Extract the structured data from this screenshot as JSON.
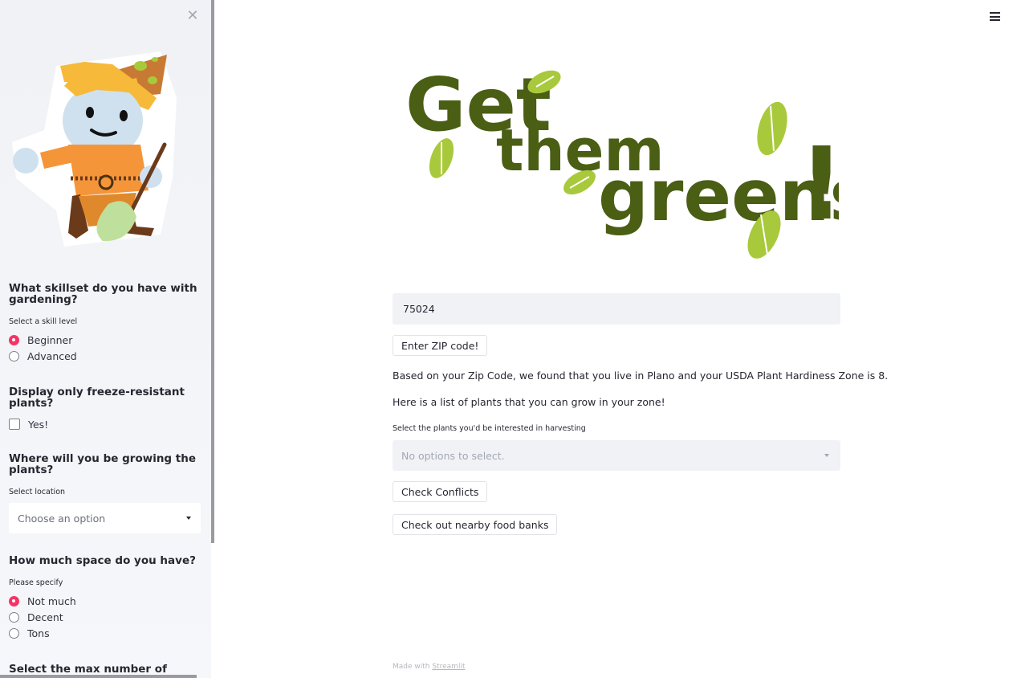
{
  "sidebar": {
    "close_icon": "close-icon",
    "skill": {
      "heading": "What skillset do you have with gardening?",
      "caption": "Select a skill level",
      "options": [
        {
          "label": "Beginner",
          "selected": true
        },
        {
          "label": "Advanced",
          "selected": false
        }
      ]
    },
    "freeze": {
      "heading": "Display only freeze-resistant plants?",
      "checkbox_label": "Yes!",
      "checked": false
    },
    "location": {
      "heading": "Where will you be growing the plants?",
      "caption": "Select location",
      "placeholder": "Choose an option"
    },
    "space": {
      "heading": "How much space do you have?",
      "caption": "Please specify",
      "options": [
        {
          "label": "Not much",
          "selected": true
        },
        {
          "label": "Decent",
          "selected": false
        },
        {
          "label": "Tons",
          "selected": false
        }
      ]
    },
    "months": {
      "heading": "Select the max number of months"
    }
  },
  "main": {
    "menu_icon": "hamburger-menu-icon",
    "logo_text": [
      "Get",
      "them",
      "greens",
      "!"
    ],
    "zip_value": "75024",
    "enter_zip_button": "Enter ZIP code!",
    "result_text": "Based on your Zip Code, we found that you live in Plano and your USDA Plant Hardiness Zone is 8.",
    "list_intro": "Here is a list of plants that you can grow in your zone!",
    "harvest_caption": "Select the plants you'd be interested in harvesting",
    "harvest_placeholder": "No options to select.",
    "check_conflicts_button": "Check Conflicts",
    "food_banks_button": "Check out nearby food banks",
    "footer_prefix": "Made with",
    "footer_link": "Streamlit"
  },
  "colors": {
    "accent": "#f63366",
    "sidebar_bg": "#f0f2f6",
    "logo_green": "#4a5e14",
    "leaf_green": "#a9c93c"
  }
}
